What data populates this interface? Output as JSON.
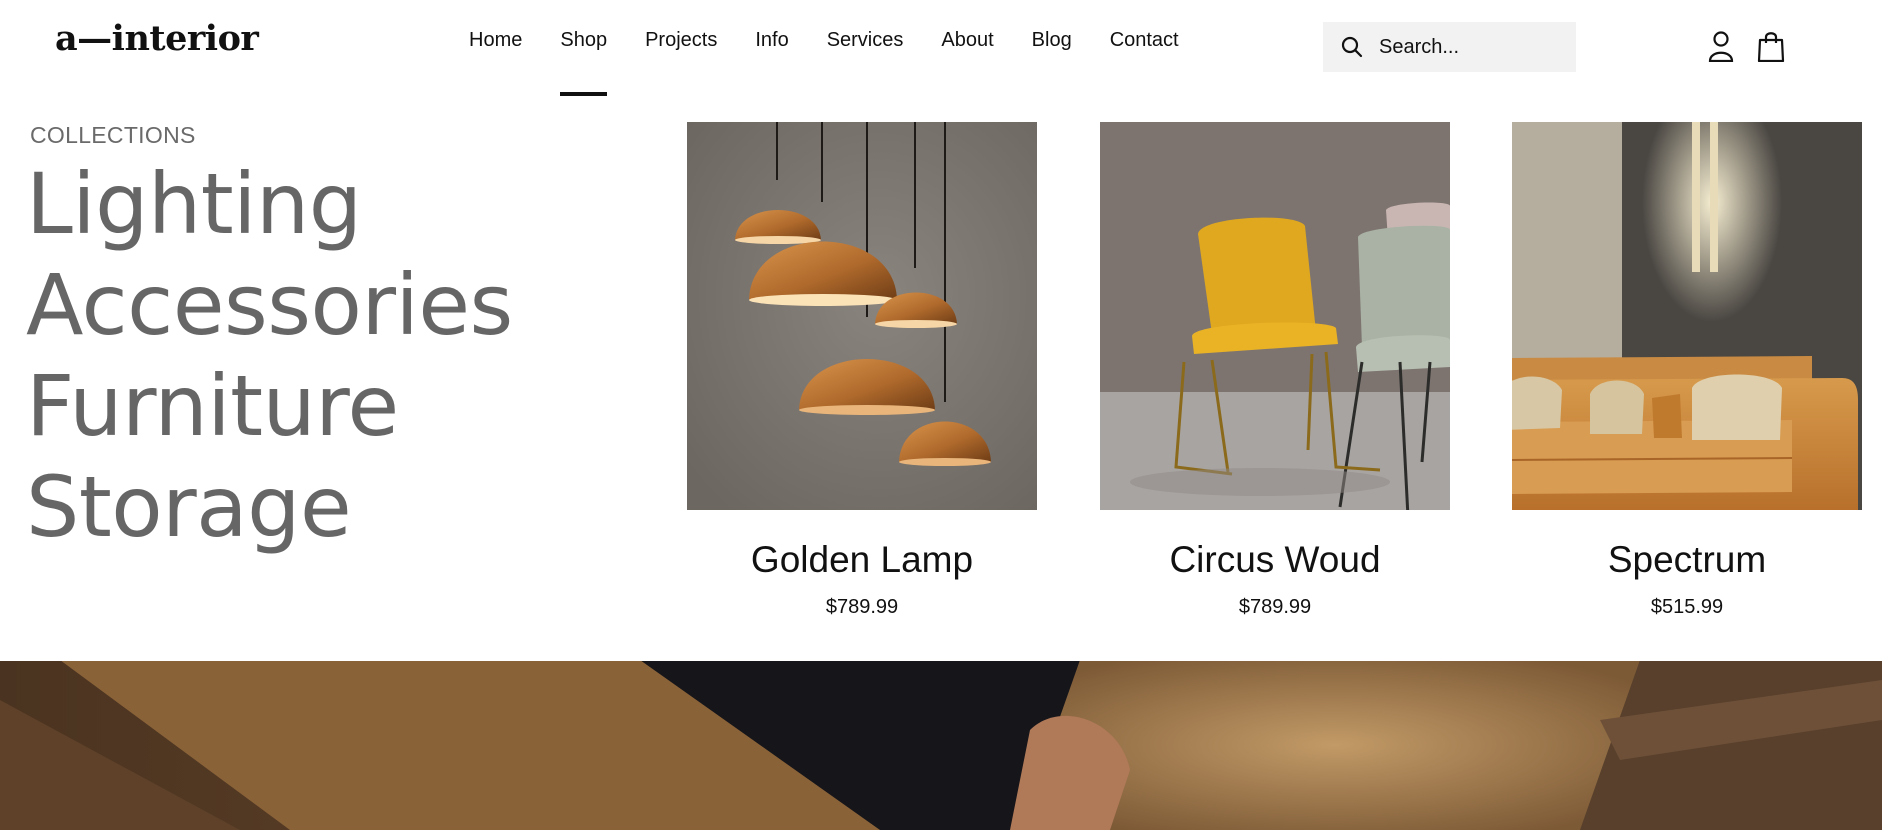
{
  "brand": {
    "logo": "a—interior"
  },
  "nav": {
    "items": [
      {
        "label": "Home"
      },
      {
        "label": "Shop",
        "active": true
      },
      {
        "label": "Projects"
      },
      {
        "label": "Info"
      },
      {
        "label": "Services"
      },
      {
        "label": "About"
      },
      {
        "label": "Blog"
      },
      {
        "label": "Contact"
      }
    ]
  },
  "search": {
    "placeholder": "Search...",
    "icon": "search-icon"
  },
  "header_icons": {
    "account": "user-icon",
    "cart": "shopping-bag-icon"
  },
  "mega_menu": {
    "collections_label": "COLLECTIONS",
    "collections": [
      "Lighting",
      "Accessories",
      "Furniture",
      "Storage"
    ],
    "products": [
      {
        "name": "Golden Lamp",
        "price": "$789.99",
        "image": "copper pendant lamps"
      },
      {
        "name": "Circus Woud",
        "price": "$789.99",
        "image": "yellow and sage chairs"
      },
      {
        "name": "Spectrum",
        "price": "$515.99",
        "image": "tan leather sofa with wall light"
      }
    ]
  },
  "colors": {
    "text": "#111111",
    "muted": "#666666",
    "search_bg": "#f2f2f2",
    "accent": "#111111"
  }
}
